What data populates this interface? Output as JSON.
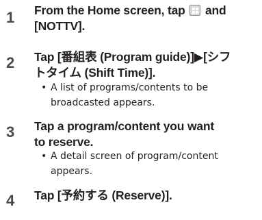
{
  "steps": [
    {
      "number": "1",
      "title_pre": "From the Home screen, tap",
      "title_post": "and",
      "title_line2": "[NOTTV].",
      "icon": "grid-app-icon"
    },
    {
      "number": "2",
      "title_line1": "Tap [番組表 (Program guide)]▶[シフ",
      "title_line2": "トタイム (Shift Time)].",
      "bullet_marker": "•",
      "bullet_line1": "A list of programs/contents to be",
      "bullet_line2": "broadcasted appears."
    },
    {
      "number": "3",
      "title_line1": "Tap a program/content you want",
      "title_line2": "to reserve.",
      "bullet_marker": "•",
      "bullet_line1": "A detail screen of program/content",
      "bullet_line2": "appears."
    },
    {
      "number": "4",
      "title_line1": "Tap [予約する (Reserve)]."
    }
  ]
}
